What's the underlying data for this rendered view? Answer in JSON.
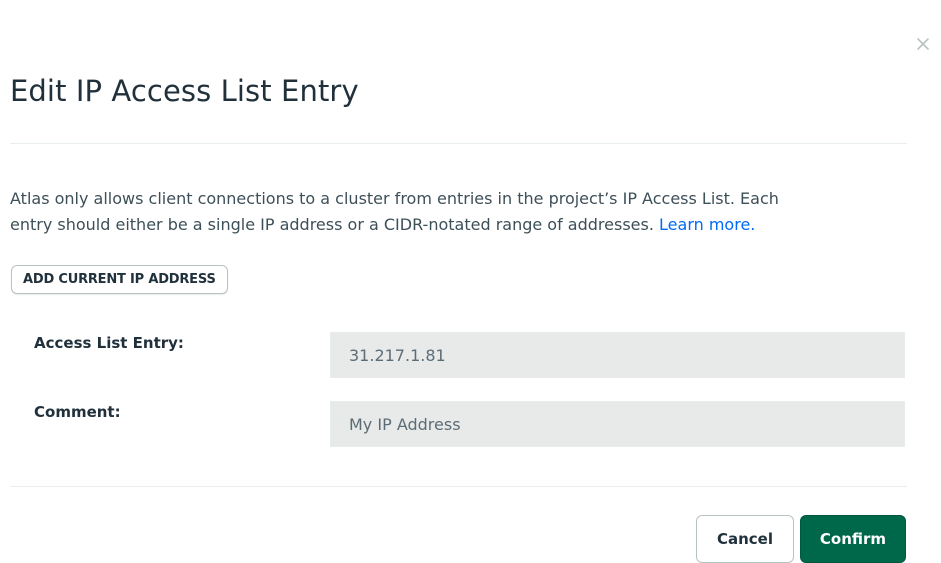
{
  "dialog": {
    "title": "Edit IP Access List Entry",
    "close_icon": "close-icon",
    "description_line1": "Atlas only allows client connections to a cluster from entries in the project’s IP Access List. Each",
    "description_line2": "entry should either be a single IP address or a CIDR-notated range of addresses.",
    "learn_more_link": "Learn more.",
    "add_current_ip_label": "ADD CURRENT IP ADDRESS",
    "fields": {
      "entry_label": "Access List Entry:",
      "entry_value": "31.217.1.81",
      "comment_label": "Comment:",
      "comment_value": "My IP Address"
    },
    "buttons": {
      "cancel": "Cancel",
      "confirm": "Confirm"
    }
  },
  "colors": {
    "primary_button": "#00684a",
    "link": "#016bf8",
    "input_background": "#e8eaea"
  }
}
